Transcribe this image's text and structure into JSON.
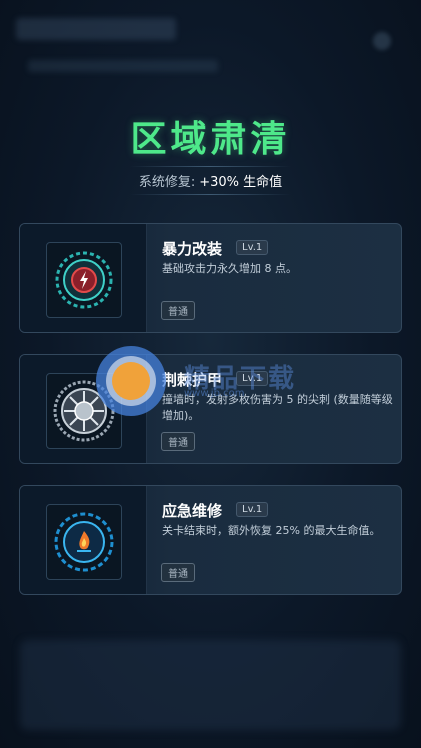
{
  "header": {
    "title": "区域肃清",
    "bonus_label": "系统修复:",
    "bonus_value": "+30%  生命值"
  },
  "upgrades": [
    {
      "name": "暴力改装",
      "level": "Lv.1",
      "description": "基础攻击力永久增加 8 点。",
      "rarity": "普通",
      "icon": "lightning-gear-icon"
    },
    {
      "name": "荆棘护甲",
      "level": "Lv.1",
      "description": "撞墙时，发射多枚伤害为 5 的尖刺 (数量随等级增加)。",
      "rarity": "普通",
      "icon": "spiked-armor-icon"
    },
    {
      "name": "应急维修",
      "level": "Lv.1",
      "description": "关卡结束时，额外恢复 25% 的最大生命值。",
      "rarity": "普通",
      "icon": "repair-flame-icon"
    }
  ],
  "watermark": {
    "text": "精品下载",
    "url": "www.jb.com"
  },
  "colors": {
    "title": "#4ee88a",
    "background": "#0b1726",
    "card_border": "#33485d"
  }
}
